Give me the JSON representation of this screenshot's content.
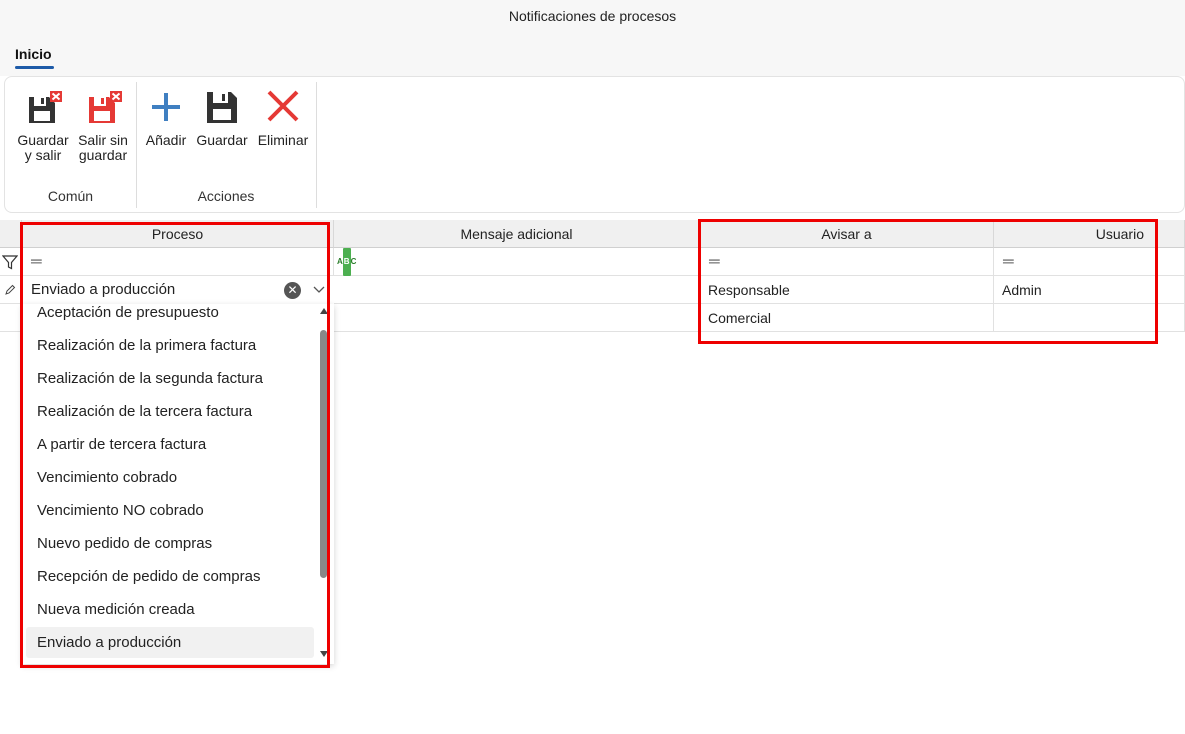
{
  "window": {
    "title": "Notificaciones de procesos"
  },
  "ribbon": {
    "tab_label": "Inicio",
    "buttons": {
      "save_exit": {
        "line1": "Guardar",
        "line2": "y salir"
      },
      "exit_nosave": {
        "line1": "Salir sin",
        "line2": "guardar"
      },
      "add": "Añadir",
      "save": "Guardar",
      "delete": "Eliminar"
    },
    "groups": {
      "common": "Común",
      "actions": "Acciones"
    },
    "colors": {
      "icon_dark": "#333333",
      "icon_red": "#e53935",
      "icon_blue": "#3f7fc1"
    }
  },
  "grid": {
    "columns": [
      "Proceso",
      "Mensaje adicional",
      "Avisar a",
      "Usuario"
    ],
    "filter": {
      "eq": "═",
      "abc_a": "A",
      "abc_b": "B",
      "abc_c": "C"
    },
    "rows": [
      {
        "proceso": "Enviado a producción",
        "mensaje": "",
        "avisar": "Responsable",
        "usuario": "Admin"
      },
      {
        "proceso": "",
        "mensaje": "",
        "avisar": "Comercial",
        "usuario": ""
      }
    ],
    "clear_glyph": "✕"
  },
  "dropdown": {
    "options": [
      "Aceptación de presupuesto",
      "Realización de la primera factura",
      "Realización de la segunda factura",
      "Realización de la tercera factura",
      "A partir de tercera factura",
      "Vencimiento cobrado",
      "Vencimiento NO cobrado",
      "Nuevo pedido de compras",
      "Recepción de pedido de compras",
      "Nueva medición creada",
      "Enviado a producción"
    ],
    "selected": "Enviado a producción"
  },
  "highlight_color": "#ee0000"
}
